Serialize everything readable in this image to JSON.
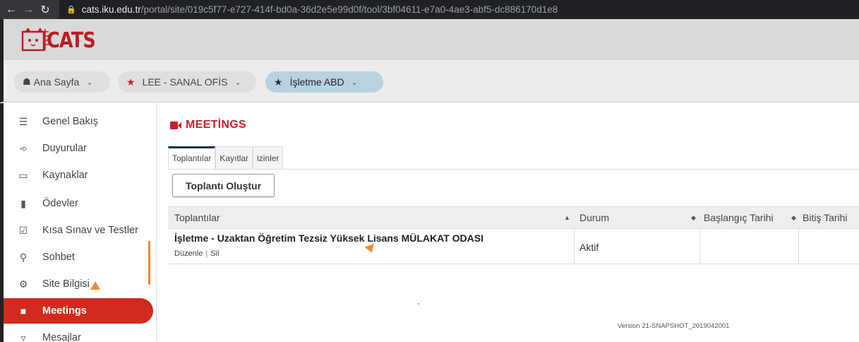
{
  "browser": {
    "url_host": "cats.iku.edu.tr",
    "url_path": "/portal/site/019c5f77-e727-414f-bd0a-36d2e5e99d0f/tool/3bf04611-e7a0-4ae3-abf5-dc886170d1e8"
  },
  "banner": {
    "logo_text": "CATS",
    "brand_color": "#b71f24"
  },
  "site_nav": {
    "items": [
      {
        "label": "Ana Sayfa",
        "icon": "home-icon"
      },
      {
        "label": "LEE - SANAL OFİS",
        "icon": "star-icon"
      },
      {
        "label": "İşletme ABD",
        "icon": "star-icon",
        "active": true
      }
    ]
  },
  "sidebar": {
    "items": [
      {
        "label": "Genel Bakış",
        "icon": "list-icon"
      },
      {
        "label": "Duyurular",
        "icon": "megaphone-icon"
      },
      {
        "label": "Kaynaklar",
        "icon": "folder-icon"
      },
      {
        "label": "Ödevler",
        "icon": "file-icon"
      },
      {
        "label": "Kısa Sınav ve Testler",
        "icon": "checkbox-icon"
      },
      {
        "label": "Sohbet",
        "icon": "chat-icon"
      },
      {
        "label": "Site Bilgisi",
        "icon": "gear-icon"
      },
      {
        "label": "Meetings",
        "icon": "video-camera-icon",
        "active": true
      },
      {
        "label": "Mesajlar",
        "icon": "inbox-icon"
      }
    ]
  },
  "tool": {
    "title": "MEETİNGS",
    "tabs": [
      "Toplantılar",
      "Kayıtlar",
      "izinler"
    ],
    "create_button": "Toplantı Oluştur",
    "table": {
      "headers": [
        "Toplantılar",
        "Durum",
        "Başlangıç Tarihi",
        "Bitiş Tarihi"
      ],
      "rows": [
        {
          "title": "İşletme - Uzaktan Öğretim Tezsiz Yüksek Lisans MÜLAKAT ODASI",
          "edit": "Düzenle",
          "separator": "|",
          "delete": "Sil",
          "status": "Aktif",
          "start": "",
          "end": ""
        }
      ]
    },
    "version": "Version 21-SNAPSHOT_2019042001"
  },
  "colors": {
    "accent_red": "#d22a1e",
    "active_tab": "#17324c",
    "annotation_orange": "#f28a38"
  }
}
